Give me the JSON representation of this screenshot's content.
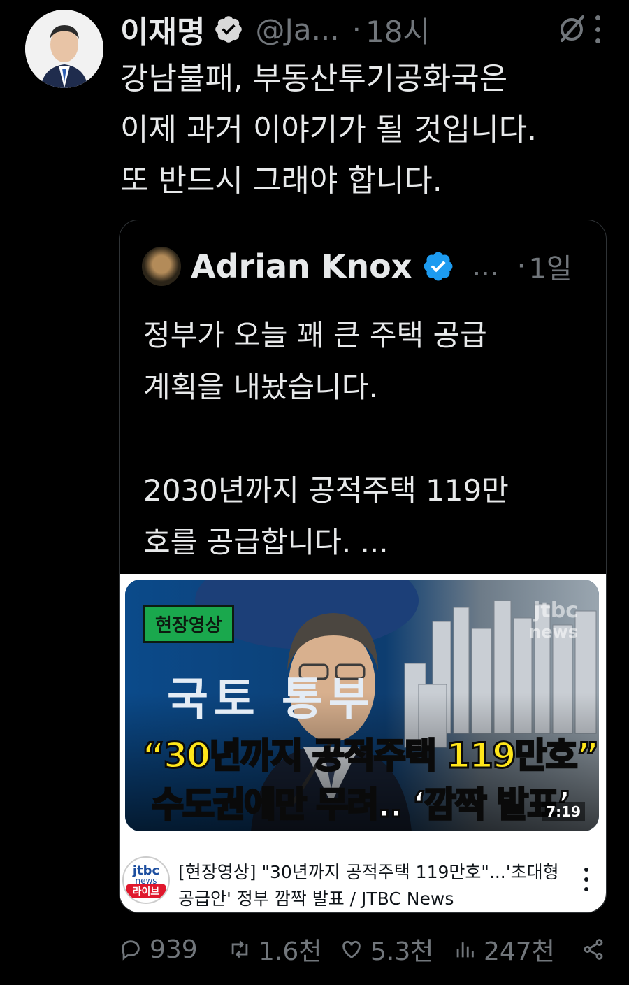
{
  "author": {
    "name": "이재명",
    "handle": "@Ja...",
    "time": "18시"
  },
  "tweet": {
    "text": "강남불패, 부동산투기공화국은\n이제 과거 이야기가 될 것입니다.\n또 반드시 그래야 합니다."
  },
  "quote": {
    "name": "Adrian Knox",
    "ellipsis": "...",
    "time": "1일",
    "text": "정부가 오늘 꽤 큰 주택 공급\n계획을 내놨습니다.\n\n2030년까지 공적주택 119만\n호를 공급합니다. ...",
    "card": {
      "tag": "현장영상",
      "ministry": "국토  통부",
      "headline1": "“30년까지 공적주택 119만호”",
      "headline2": "수도권에만 무려.. ‘깜짝 발표’",
      "watermark": "jtbc",
      "watermark_sub": "news",
      "duration": "7:19",
      "channel_logo": "jtbc",
      "channel_logo_sub": "news",
      "channel_live": "라이브",
      "title": "[현장영상] \"30년까지 공적주택 119만호\"...'초대형\n공급안' 정부 깜짝 발표 / JTBC News"
    }
  },
  "actions": {
    "replies": "939",
    "retweets": "1.6천",
    "likes": "5.3천",
    "views": "247천"
  },
  "colors": {
    "background": "#000000",
    "text": "#e7e9ea",
    "secondary": "#71767b",
    "verified": "#1d9bf0",
    "headline_yellow": "#ffe61a"
  }
}
